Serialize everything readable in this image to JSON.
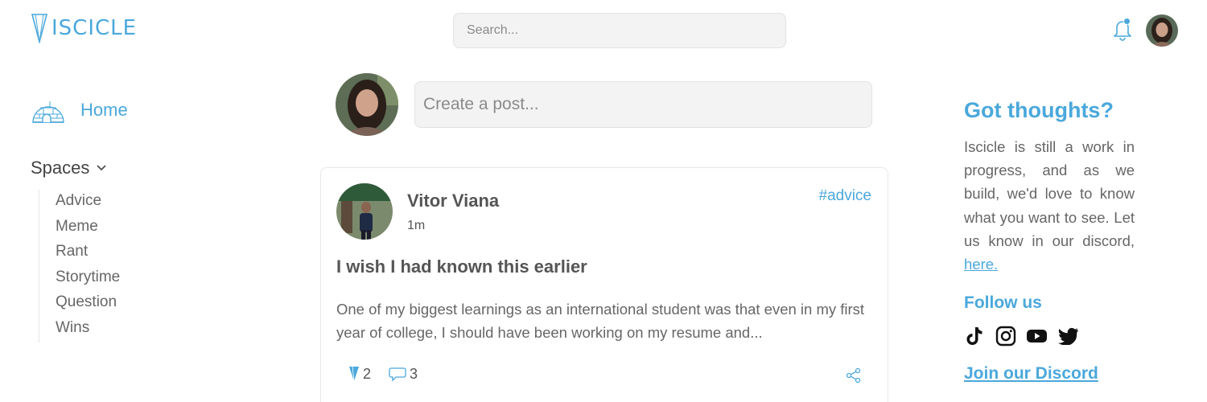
{
  "header": {
    "logo_text": "ISCICLE",
    "search_placeholder": "Search...",
    "notification_icon": "bell-icon",
    "accent_color": "#4aa8dc"
  },
  "sidebar": {
    "home_label": "Home",
    "home_icon": "igloo-icon",
    "spaces_label": "Spaces",
    "spaces_items": [
      "Advice",
      "Meme",
      "Rant",
      "Storytime",
      "Question",
      "Wins"
    ]
  },
  "composer": {
    "placeholder": "Create a post..."
  },
  "post": {
    "author": "Vitor Viana",
    "time": "1m",
    "tag": "#advice",
    "title": "I wish I had known this earlier",
    "body": "One of my biggest learnings as an international student was that even in my first year of college, I should have been working on my resume and...",
    "likes": "2",
    "comments": "3"
  },
  "right_sidebar": {
    "title": "Got thoughts?",
    "text": "Iscicle is still a work in progress, and as we build, we'd love to know what you want to see. Let us know in our discord,",
    "link_text": "here.",
    "follow_title": "Follow us",
    "socials": [
      "tiktok-icon",
      "instagram-icon",
      "youtube-icon",
      "twitter-icon"
    ],
    "discord_label": "Join our Discord"
  }
}
